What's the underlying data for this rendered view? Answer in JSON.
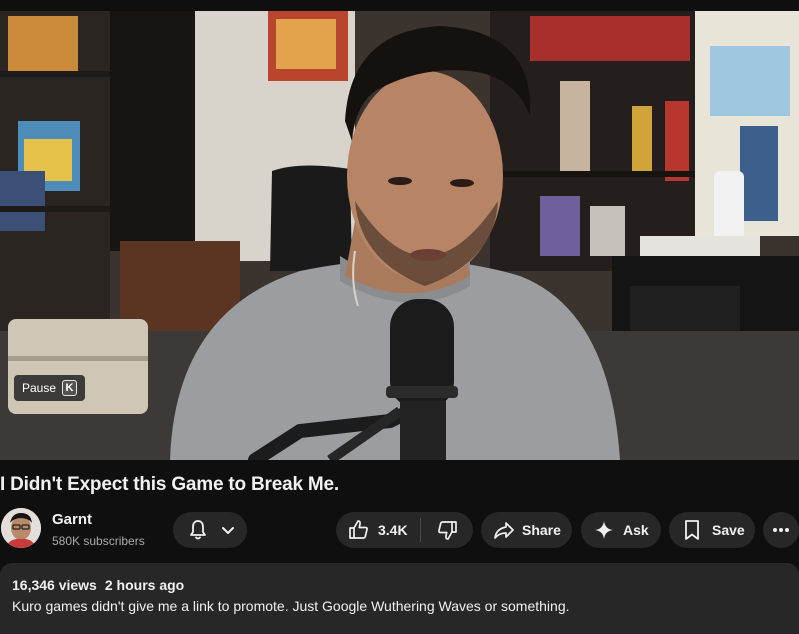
{
  "video": {
    "pause_label": "Pause",
    "pause_key": "K"
  },
  "title": "I Didn't Expect this Game to Break Me.",
  "channel": {
    "name": "Garnt",
    "subscribers": "580K subscribers"
  },
  "actions": {
    "likes": "3.4K",
    "share": "Share",
    "ask": "Ask",
    "save": "Save"
  },
  "icons": [
    "bell-icon",
    "chevron-down-icon",
    "thumb-up-icon",
    "thumb-down-icon",
    "share-icon",
    "sparkle-icon",
    "bookmark-icon",
    "more-icon"
  ],
  "description": {
    "views": "16,346 views",
    "age": "2 hours ago",
    "text": "Kuro games didn't give me a link to promote. Just Google Wuthering Waves or something."
  },
  "colors": {
    "background": "#0f0f0f",
    "button": "#272727",
    "text": "#f1f1f1",
    "secondary_text": "#aaaaaa"
  }
}
